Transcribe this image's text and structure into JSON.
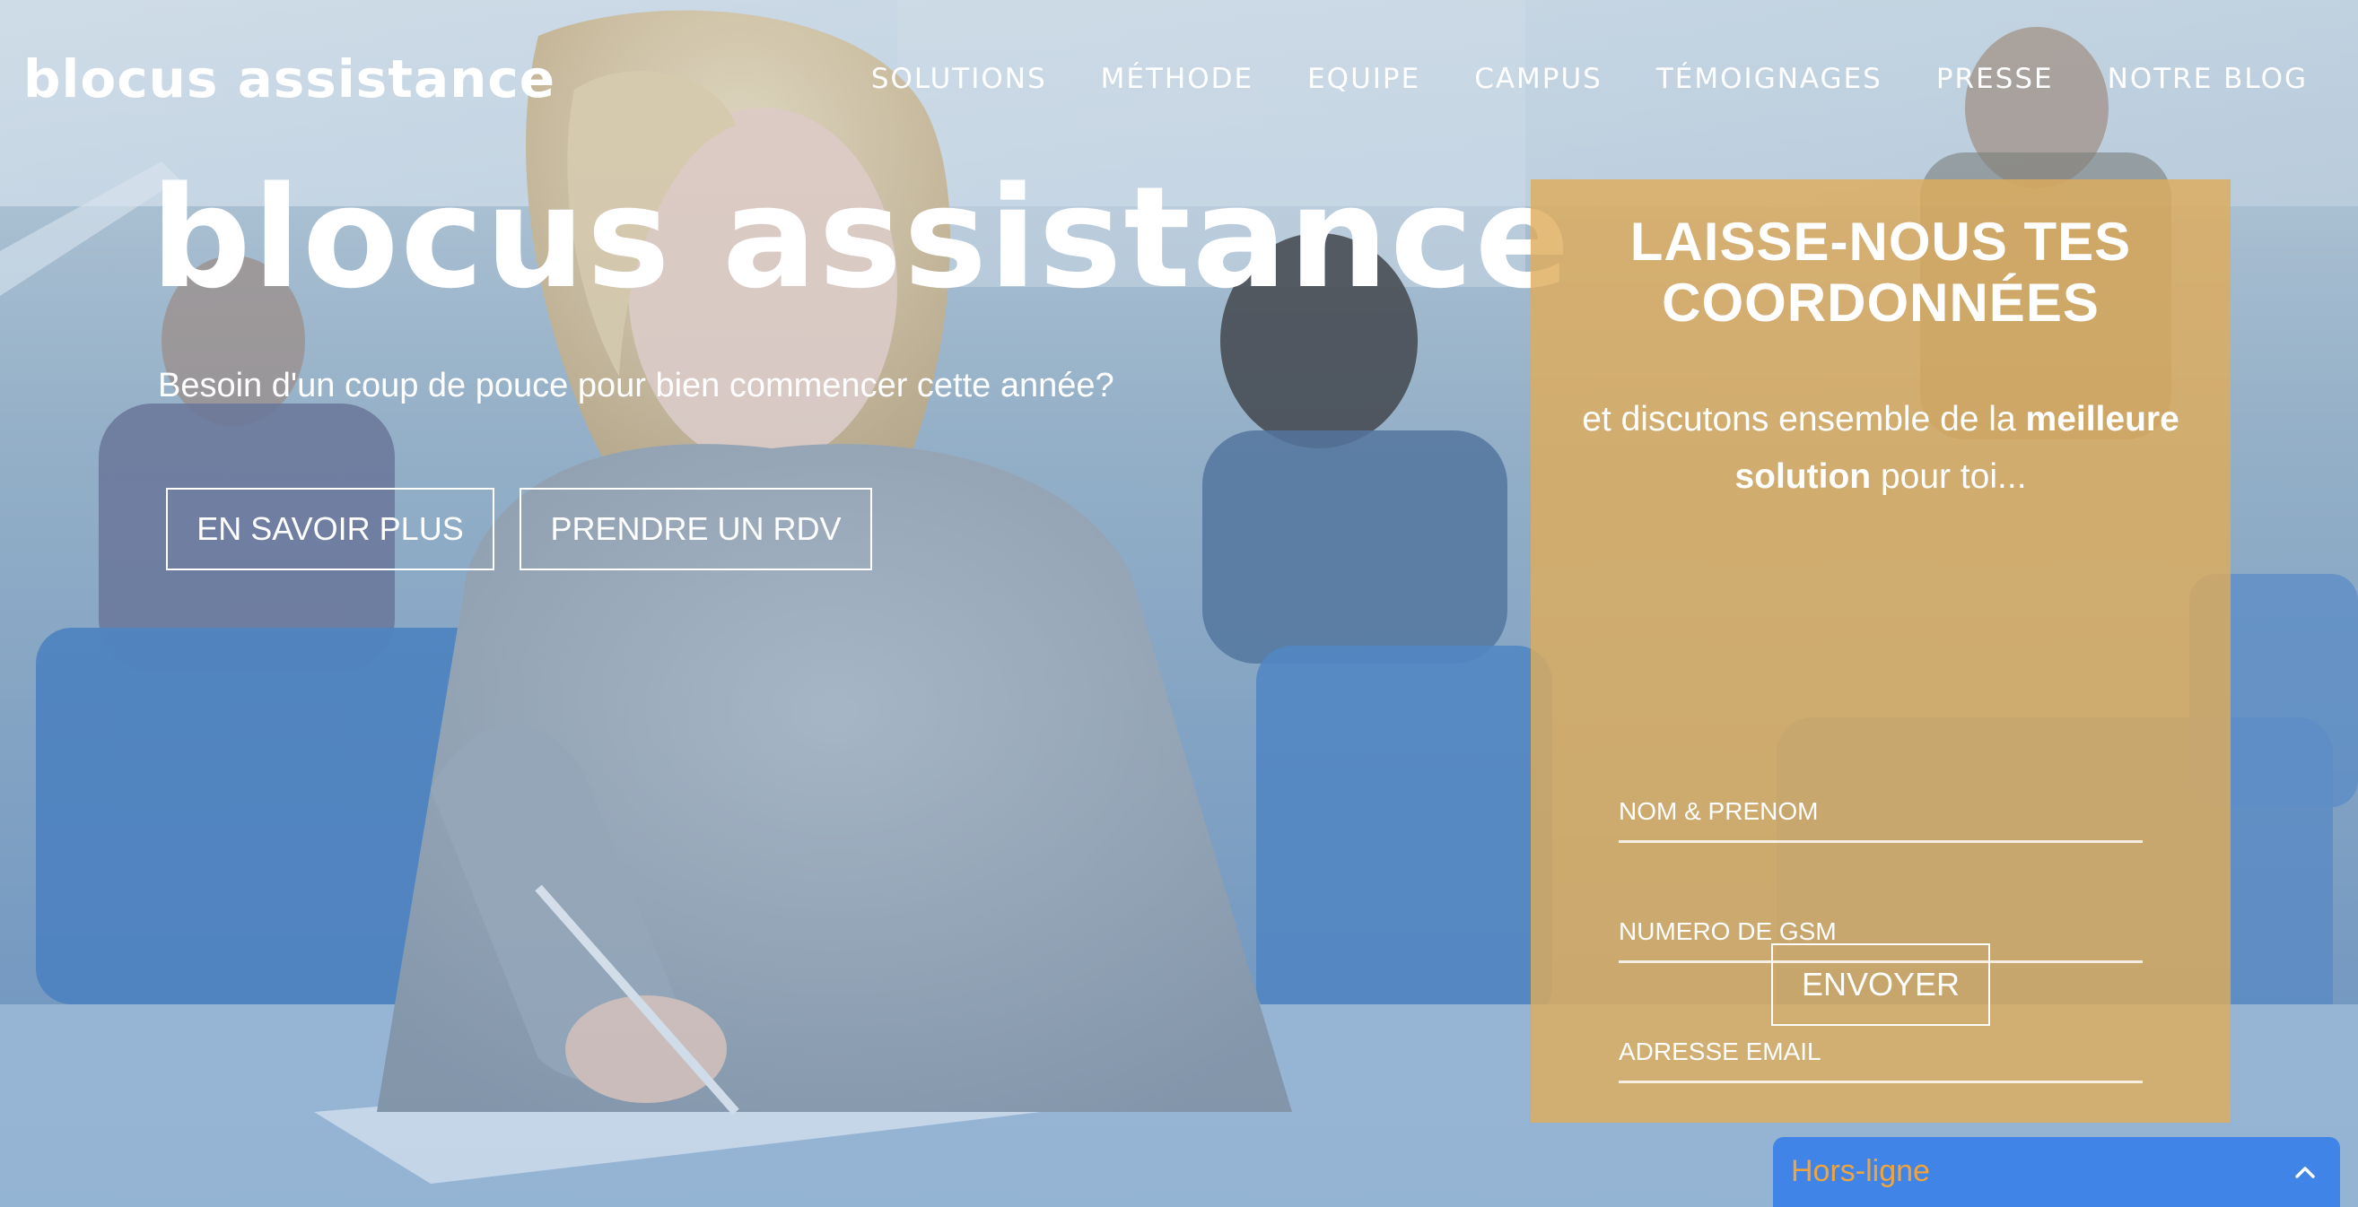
{
  "header": {
    "logo": "blocus assistance",
    "nav": [
      {
        "label": "SOLUTIONS"
      },
      {
        "label": "MÉTHODE"
      },
      {
        "label": "EQUIPE"
      },
      {
        "label": "CAMPUS"
      },
      {
        "label": "TÉMOIGNAGES"
      },
      {
        "label": "PRESSE"
      },
      {
        "label": "NOTRE BLOG"
      }
    ]
  },
  "hero": {
    "logo": "blocus assistance",
    "subtitle": "Besoin d'un coup de pouce pour bien commencer cette année?",
    "buttons": {
      "more": "EN SAVOIR PLUS",
      "rdv": "PRENDRE UN RDV"
    }
  },
  "form": {
    "title_line1": "LAISSE-NOUS TES",
    "title_line2": "COORDONNÉES",
    "desc_part1": "et discutons ensemble de la",
    "desc_bold1": "meilleure",
    "desc_bold2": "solution",
    "desc_part2": "pour toi...",
    "fields": {
      "name": "NOM & PRENOM",
      "phone": "NUMERO DE GSM",
      "email": "ADRESSE EMAIL"
    },
    "submit": "ENVOYER"
  },
  "chat": {
    "status": "Hors-ligne"
  },
  "colors": {
    "form_panel": "#deac5c",
    "chat_bar": "#3f84e6",
    "chat_text": "#f2a43c"
  }
}
